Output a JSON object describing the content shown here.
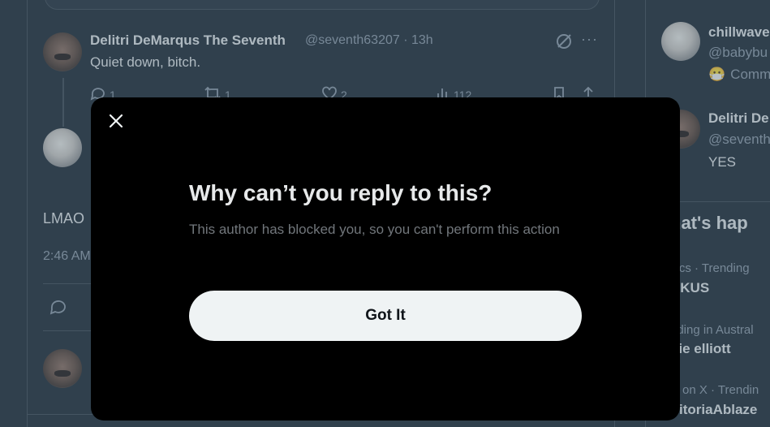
{
  "tweet": {
    "author_name": "Delitri DeMarqus The Seventh",
    "handle_time": "@seventh63207 · 13h",
    "text": "Quiet down, bitch.",
    "reply_count": "1",
    "retweet_count": "1",
    "like_count": "2",
    "view_count": "112"
  },
  "main_post": {
    "text_partial": "LMAO",
    "time_partial": "2:46 AM"
  },
  "sidebar": {
    "user1_name": "chillwave",
    "user1_handle": "@babybu",
    "user1_community": "Comm",
    "user2_name": "Delitri De",
    "user2_handle": "@seventh",
    "user2_text": "YES",
    "trends_title": "hat's hap",
    "trends": [
      {
        "meta": "itics · Trending",
        "name": "UKUS"
      },
      {
        "meta": "nding in Austral",
        "name": "nie elliott"
      },
      {
        "meta": "ly on X · Trendin",
        "name": "VitoriaAblaze"
      }
    ]
  },
  "modal": {
    "title": "Why can’t you reply to this?",
    "body": "This author has blocked you, so you can't perform this action",
    "button_label": "Got It",
    "close_icon": "close-icon"
  },
  "colors": {
    "background": "#15202b",
    "modal_background": "#000000",
    "button_background": "#eff3f4",
    "secondary_text": "#8b98a5"
  }
}
